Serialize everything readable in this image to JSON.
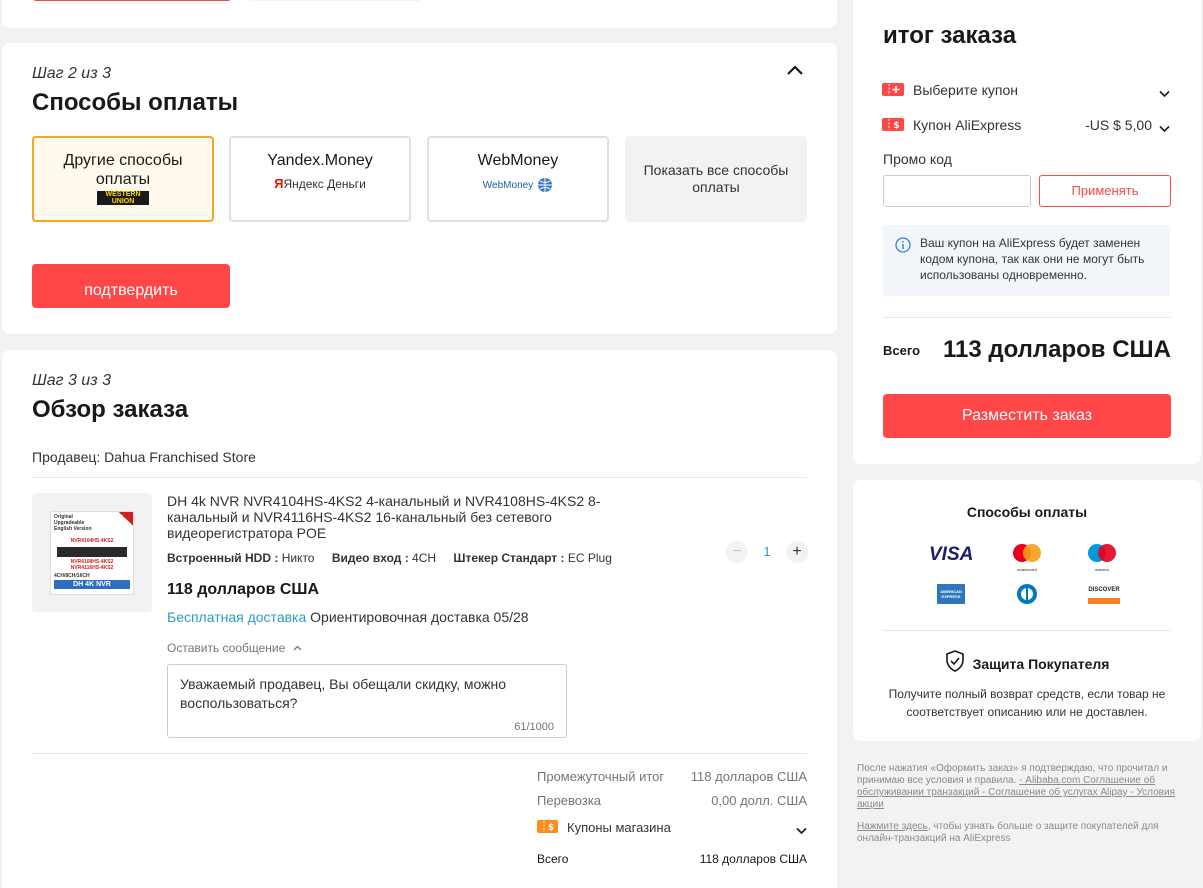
{
  "step2": {
    "step_label": "Шаг 2 из 3",
    "title": "Способы оплаты",
    "methods": [
      {
        "label": "Другие способы оплаты",
        "logo": "WESTERN UNION"
      },
      {
        "label": "Yandex.Money",
        "logo": "Яндекс Деньги"
      },
      {
        "label": "WebMoney",
        "logo": "WebMoney"
      },
      {
        "label": "Показать все способы оплаты"
      }
    ],
    "confirm": "подтвердить"
  },
  "step3": {
    "step_label": "Шаг 3 из 3",
    "title": "Обзор заказа",
    "seller": "Продавец: Dahua Franchised Store",
    "product": {
      "title": "DH 4k NVR NVR4104HS-4KS2 4-канальный и NVR4108HS-4KS2 8-канальный и NVR4116HS-4KS2 16-канальный без сетевого видеорегистратора POE",
      "img_lines": [
        "Original",
        "Upgradeable",
        "English Version",
        "NVR4104HS-4KS2",
        "NVR4108HS-4KS2",
        "NVR4116HS-4KS2",
        "4CH/8CH/16CH",
        "DH 4K NVR"
      ],
      "spec1_k": "Встроенный HDD :",
      "spec1_v": "Никто",
      "spec2_k": "Видео вход :",
      "spec2_v": "4CH",
      "spec3_k": "Штекер Стандарт :",
      "spec3_v": "EC Plug",
      "price": "118 долларов США",
      "free_shipping": "Бесплатная доставка",
      "delivery": "Ориентировочная доставка 05/28",
      "qty": "1",
      "leave_msg": "Оставить сообщение",
      "message": "Уважаемый продавец, Вы обещали скидку, можно воспользоваться?",
      "counter": "61/1000"
    },
    "summary": {
      "subtotal_label": "Промежуточный итог",
      "subtotal": "118 долларов США",
      "shipping_label": "Перевозка",
      "shipping": "0,00 долл. США",
      "store_coupons": "Купоны магазина",
      "total_label": "Всего",
      "total": "118 долларов США"
    }
  },
  "order_summary": {
    "title": "итог заказа",
    "choose_coupon": "Выберите купон",
    "ae_coupon": "Купон AliExpress",
    "ae_coupon_value": "-US $ 5,00",
    "promo_label": "Промо код",
    "promo_placeholder": "",
    "apply": "Применять",
    "info": "Ваш купон на AliExpress будет заменен кодом купона, так как они не могут быть использованы одновременно.",
    "total_label": "Всего",
    "total": "113 долларов США",
    "place_order": "Разместить заказ"
  },
  "payment_methods": {
    "title": "Способы оплаты",
    "logos": [
      "VISA",
      "mastercard",
      "maestro",
      "AMERICAN EXPRESS",
      "Diners Club",
      "DISCOVER"
    ]
  },
  "protection": {
    "title": "Защита Покупателя",
    "text": "Получите полный возврат средств, если товар не соответствует описанию или не доставлен."
  },
  "legal": {
    "p1_text": "После нажатия «Оформить заказ» я подтверждаю, что прочитал и принимаю все условия и правила. ",
    "p1_link": "- Alibaba.com Соглашение об обслуживании транзакций - Соглашение об услугах Alipay - Условия акции",
    "p2_link": "Нажмите здесь",
    "p2_text": ", чтобы узнать больше о защите покупателей для онлайн-транзакций на AliExpress"
  },
  "colors": {
    "accent": "#ff4747",
    "selected": "#f5a623",
    "link": "#2e9cc3"
  }
}
